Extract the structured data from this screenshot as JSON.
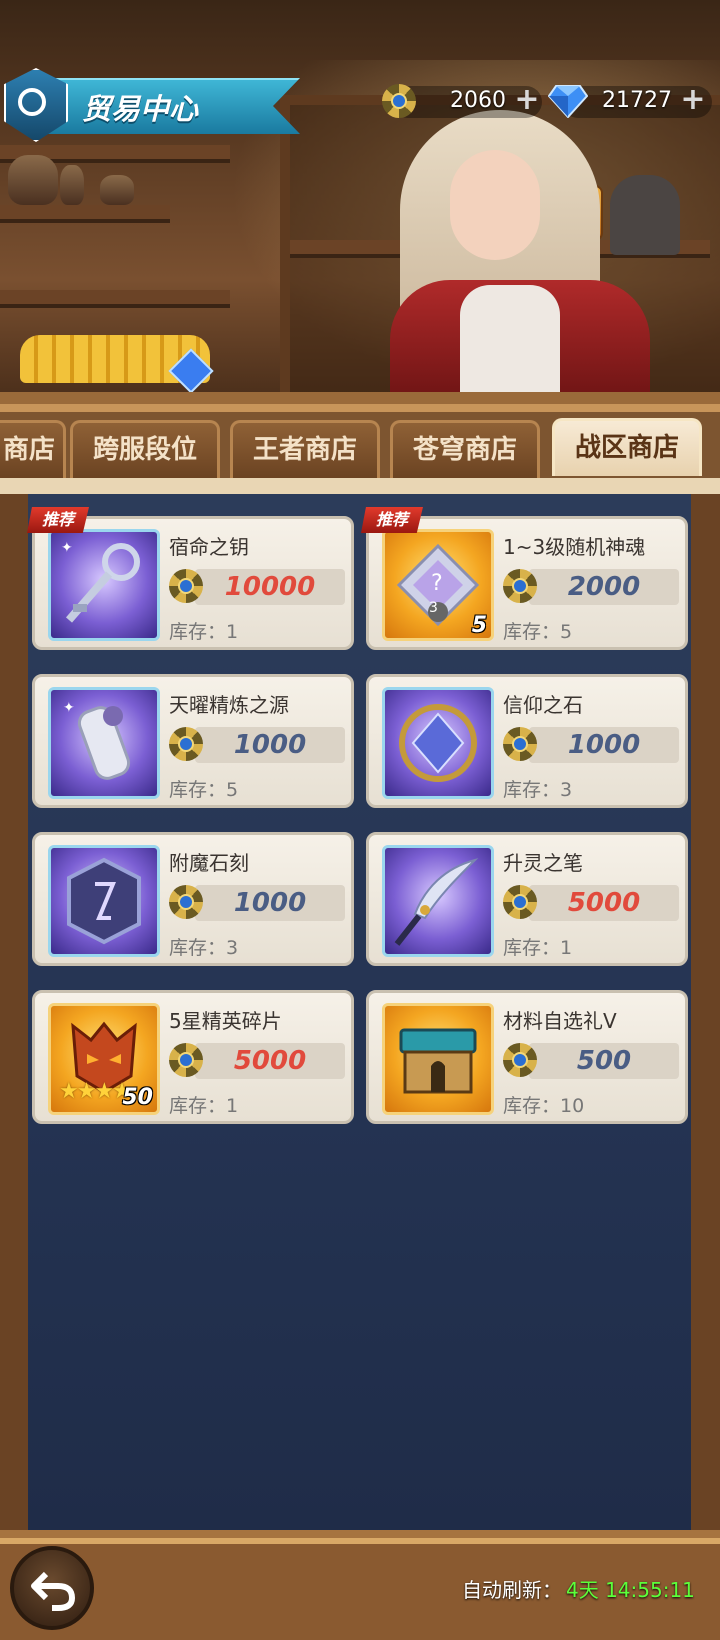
{
  "header": {
    "title": "贸易中心",
    "currencies": [
      {
        "icon": "medal-icon",
        "value": "2060",
        "add": "+"
      },
      {
        "icon": "diamond-icon",
        "value": "21727",
        "add": "+"
      }
    ]
  },
  "tabs": [
    {
      "label": "商店",
      "active": false
    },
    {
      "label": "跨服段位",
      "active": false
    },
    {
      "label": "王者商店",
      "active": false
    },
    {
      "label": "苍穹商店",
      "active": false
    },
    {
      "label": "战区商店",
      "active": true
    }
  ],
  "items": [
    {
      "name": "宿命之钥",
      "price": "10000",
      "price_color": "#e14a3c",
      "stock": "库存：1",
      "badge": "推荐",
      "icon": "key-icon"
    },
    {
      "name": "1~3级随机神魂",
      "price": "2000",
      "price_color": "#4a5d84",
      "stock": "库存：5",
      "badge": "推荐",
      "qty": "5",
      "icon": "soul-gem-icon",
      "level": "3"
    },
    {
      "name": "天曜精炼之源",
      "price": "1000",
      "price_color": "#4a5d84",
      "stock": "库存：5",
      "icon": "refine-cylinder-icon"
    },
    {
      "name": "信仰之石",
      "price": "1000",
      "price_color": "#4a5d84",
      "stock": "库存：3",
      "icon": "faith-stone-icon"
    },
    {
      "name": "附魔石刻",
      "price": "1000",
      "price_color": "#4a5d84",
      "stock": "库存：3",
      "icon": "enchant-rune-icon"
    },
    {
      "name": "升灵之笔",
      "price": "5000",
      "price_color": "#e14a3c",
      "stock": "库存：1",
      "icon": "quill-icon"
    },
    {
      "name": "5星精英碎片",
      "price": "5000",
      "price_color": "#e14a3c",
      "stock": "库存：1",
      "qty": "50",
      "icon": "elite-shard-icon",
      "stars": "★★★★"
    },
    {
      "name": "材料自选礼V",
      "price": "500",
      "price_color": "#4a5d84",
      "stock": "库存：10",
      "icon": "chest-icon"
    }
  ],
  "footer": {
    "refresh_label": "自动刷新：",
    "refresh_time": "4天 14:55:11"
  }
}
